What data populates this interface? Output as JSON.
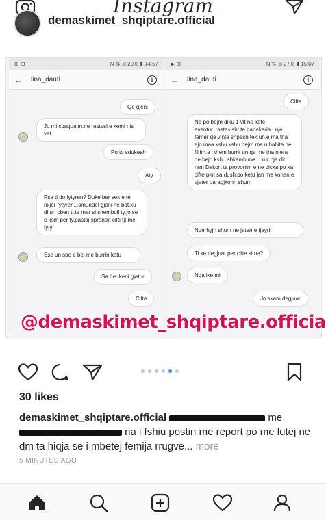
{
  "header": {
    "logo_text": "Instagram",
    "camera_icon": "camera-icon",
    "direct_icon": "paper-plane-icon"
  },
  "post": {
    "username_top": "demaskimet_shqiptare.official",
    "watermark": "@demaskimet_shqiptare.official",
    "likes": "30 likes",
    "caption_user": "demaskimet_shqiptare.official",
    "caption_start": "me",
    "caption_rest": "na i fshiu postin me report po me lutej ne dm ta hiqja se i mbetej femija rrugve...",
    "more_label": "more",
    "time_ago": "5 MINUTES AGO"
  },
  "left_phone": {
    "status_left": "⊞ ⊡",
    "status_right": "N ⇅ .ıl 29% ▮ 14:57",
    "username": "lina_dauti",
    "messages": [
      "Qe gjeni",
      "Jo mi cpaguajm.ne rastesi e kemi nis vet",
      "Po to sdukesh",
      "Aty",
      "Pse ti do fytyren? Duke ber sex e te nxjer fytyren...smundet gjalk ne bot.ku di un cben ti.te mar si shembull ty.jo se e ksm per ty.pastaj.spranon cifti tjt me fytyr",
      "Sse un spo e bej me burrin ketu",
      "Sa her keni gjetur",
      "Cifte"
    ]
  },
  "right_phone": {
    "status_left": "▶ ⊞",
    "status_right": "N ⇅ .ıl 27% ▮ 15:07",
    "username": "lina_dauti",
    "messages": [
      "Cifte",
      "Ne po bejm diku 1 vit ne kete aventur..rastesisht te panakeria...nje femer qe vinte shpesh tek un.e ma tha ajo maa kshu kshu.bejm me.u habita ne fillim.e i them burrit un.qe me tha njera qe bejn kshu shkembime....kur nje dit ram Dakort ta provonim e ne dicka.po ka cifte plot sa dush.po ketu jan me kohen e vjeter paragjkohn shum",
      "Nderhyjn shum ne jeten e tjeyrit",
      "Ti ke degjuar per cifte si ne?",
      "Nga ike mi",
      "Jo skam degjuar"
    ]
  },
  "colors": {
    "watermark": "#d0145a",
    "dot_active": "#3897f0",
    "dot_inactive": "#c7c7c7",
    "text_muted": "#999999"
  },
  "bottom_nav": [
    "home-icon",
    "search-icon",
    "add-post-icon",
    "heart-icon",
    "profile-icon"
  ]
}
